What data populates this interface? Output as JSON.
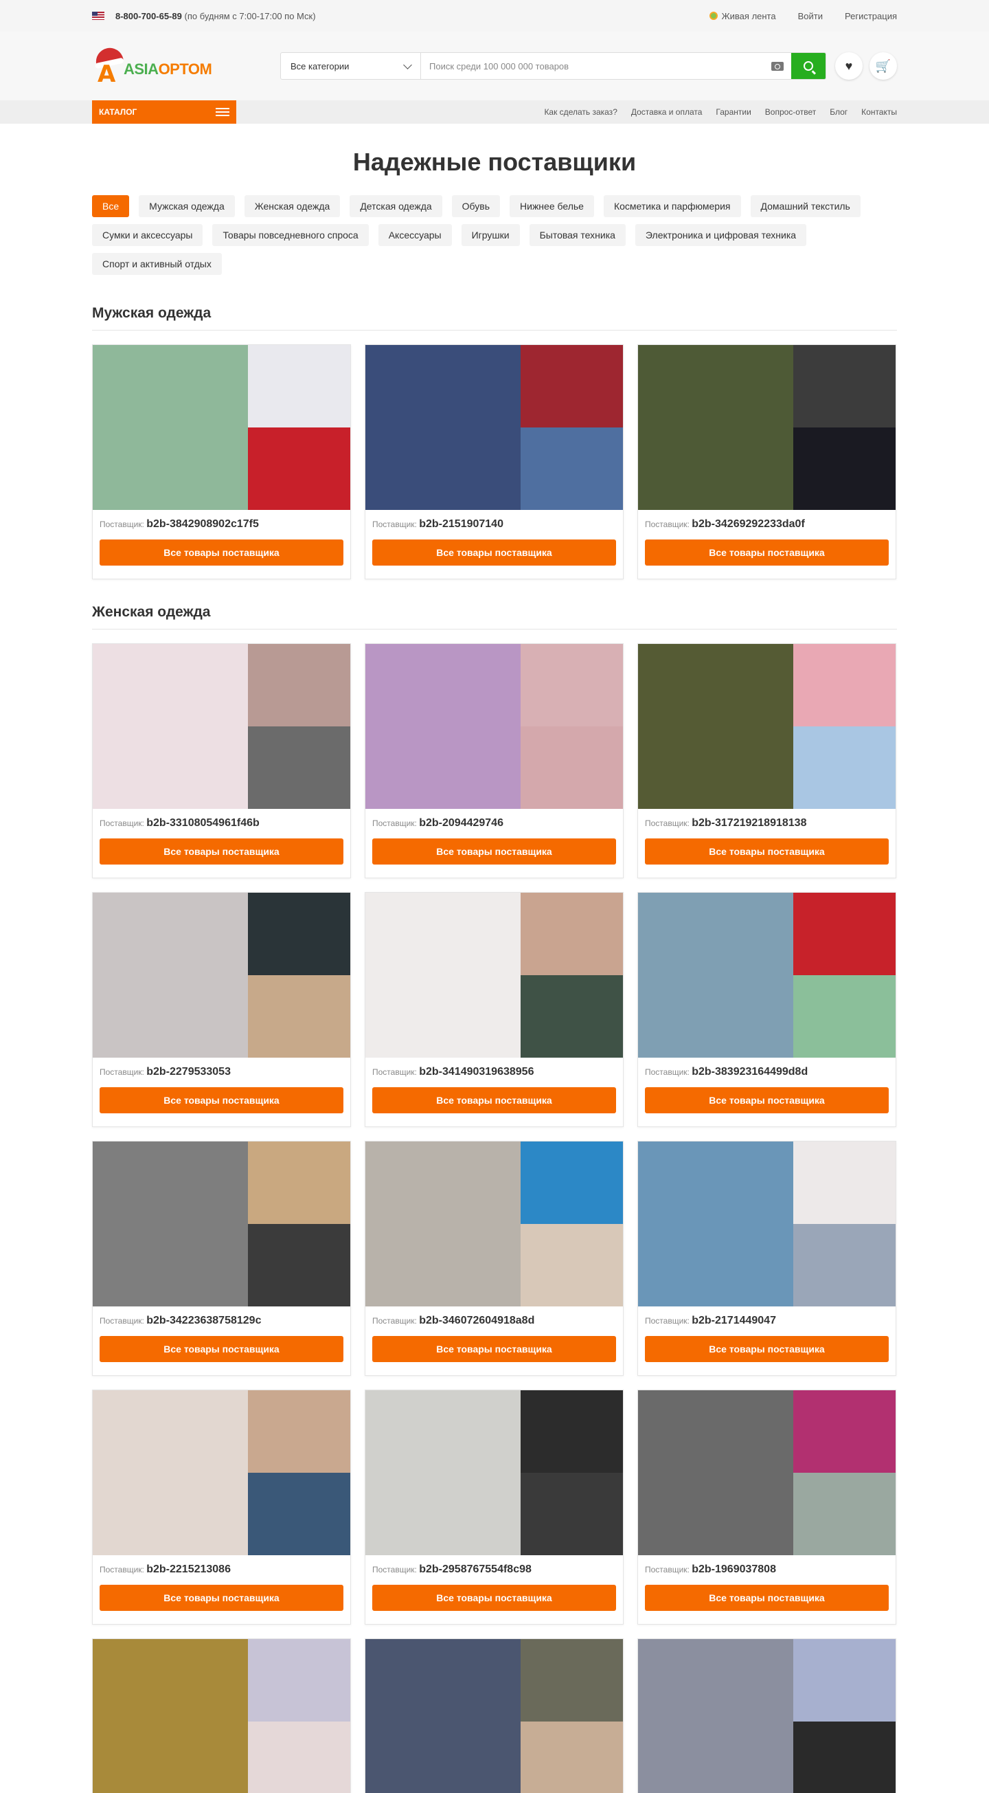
{
  "topbar": {
    "phone": "8-800-700-65-89",
    "hours": "(по будням с 7:00-17:00 по Мск)",
    "live": "Живая лента",
    "login": "Войти",
    "register": "Регистрация"
  },
  "header": {
    "logo_a": "ASIA",
    "logo_b": "OPTOM",
    "category_select": "Все категории",
    "search_placeholder": "Поиск среди 100 000 000 товаров"
  },
  "nav": {
    "catalog": "КАТАЛОГ",
    "links": [
      "Как сделать заказ?",
      "Доставка и оплата",
      "Гарантии",
      "Вопрос-ответ",
      "Блог",
      "Контакты"
    ]
  },
  "page_title": "Надежные поставщики",
  "filters": [
    "Все",
    "Мужская одежда",
    "Женская одежда",
    "Детская одежда",
    "Обувь",
    "Нижнее белье",
    "Косметика и парфюмерия",
    "Домашний текстиль",
    "Сумки и аксессуары",
    "Товары повседневного спроса",
    "Аксессуары",
    "Игрушки",
    "Бытовая техника",
    "Электроника и цифровая техника",
    "Спорт и активный отдых"
  ],
  "supplier_label": "Поставщик:",
  "button_label": "Все товары поставщика",
  "sections": [
    {
      "title": "Мужская одежда",
      "suppliers": [
        "b2b-3842908902c17f5",
        "b2b-2151907140",
        "b2b-34269292233da0f"
      ],
      "colors": [
        [
          "#8fb89a",
          "#e9e9ee",
          "#c8202a"
        ],
        [
          "#3a4d7a",
          "#9e2630",
          "#4f6fa0"
        ],
        [
          "#4e5a36",
          "#3c3c3c",
          "#1a1a22"
        ]
      ]
    },
    {
      "title": "Женская одежда",
      "suppliers": [
        "b2b-33108054961f46b",
        "b2b-2094429746",
        "b2b-317219218918138",
        "b2b-2279533053",
        "b2b-341490319638956",
        "b2b-383923164499d8d",
        "b2b-34223638758129c",
        "b2b-346072604918a8d",
        "b2b-2171449047",
        "b2b-2215213086",
        "b2b-2958767554f8c98",
        "b2b-1969037808",
        "",
        "",
        ""
      ],
      "colors": [
        [
          "#eddfe3",
          "#b89a94",
          "#6b6b6b"
        ],
        [
          "#b996c4",
          "#d8b0b4",
          "#d4a8ac"
        ],
        [
          "#555b34",
          "#e9a8b4",
          "#a9c6e3"
        ],
        [
          "#c9c4c4",
          "#2a3438",
          "#c7a98a"
        ],
        [
          "#efeceb",
          "#c9a490",
          "#3f5246"
        ],
        [
          "#7f9fb3",
          "#c7222a",
          "#8bbf9a"
        ],
        [
          "#7e7e7e",
          "#c9a880",
          "#3b3b3b"
        ],
        [
          "#b8b2aa",
          "#2c88c6",
          "#d8c8b8"
        ],
        [
          "#6a96b8",
          "#ede9e9",
          "#9aa6b8"
        ],
        [
          "#e2d7d0",
          "#c9a88f",
          "#3a5878"
        ],
        [
          "#d0d0cc",
          "#2c2c2c",
          "#3a3a3a"
        ],
        [
          "#6a6a6a",
          "#b23070",
          "#9aa8a0"
        ],
        [
          "#a88a3a",
          "#c7c3d6",
          "#e5d8d8"
        ],
        [
          "#4b5670",
          "#6a6a5a",
          "#c7ad95"
        ],
        [
          "#8b8f9f",
          "#a7b0cf",
          "#2a2a2a"
        ]
      ]
    }
  ]
}
